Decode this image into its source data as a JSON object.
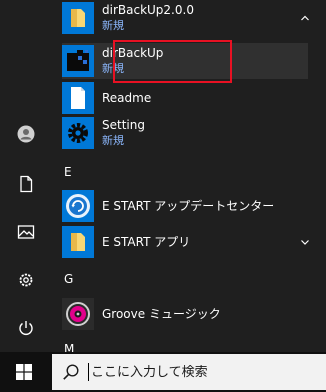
{
  "start_menu": {
    "groups": [
      {
        "type": "folder",
        "name": "dirBackUp2.0.0",
        "badge": "新規",
        "expanded": true,
        "children": [
          {
            "name": "dirBackUp",
            "badge": "新規",
            "icon": "dirbackup-app-icon",
            "selected": true
          },
          {
            "name": "Readme",
            "badge": "",
            "icon": "document-icon"
          },
          {
            "name": "Setting",
            "badge": "新規",
            "icon": "gear-icon"
          }
        ]
      }
    ],
    "letters": {
      "e": "E",
      "g": "G",
      "m": "M"
    },
    "e_items": [
      {
        "name": "E START アップデートセンター",
        "icon": "estart-update-icon"
      },
      {
        "name": "E START アプリ",
        "icon": "folder-icon",
        "expandable": true
      }
    ],
    "g_items": [
      {
        "name": "Groove ミュージック",
        "icon": "groove-music-icon"
      }
    ]
  },
  "taskbar": {
    "search_placeholder": "ここに入力して検索"
  },
  "colors": {
    "background": "#1f1f1f",
    "accent_blue": "#0078d7",
    "badge_blue": "#8ab4f8",
    "highlight_red": "#e81123",
    "taskbar": "#101010"
  }
}
